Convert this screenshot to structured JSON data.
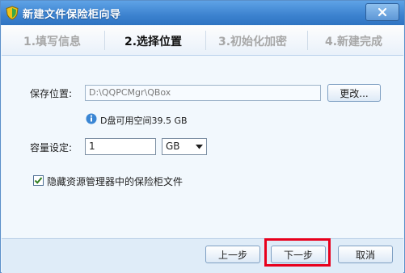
{
  "window": {
    "title": "新建文件保险柜向导",
    "close_icon": "close-icon"
  },
  "steps": [
    {
      "label": "1.填写信息",
      "active": false
    },
    {
      "label": "2.选择位置",
      "active": true
    },
    {
      "label": "3.初始化加密",
      "active": false
    },
    {
      "label": "4.新建完成",
      "active": false
    }
  ],
  "location": {
    "label": "保存位置:",
    "path_value": "D:\\QQPCMgr\\QBox",
    "change_button": "更改..."
  },
  "info": {
    "icon": "info-icon",
    "free_space_text": "D盘可用空间39.5 GB"
  },
  "capacity": {
    "label": "容量设定:",
    "value": "1",
    "unit_selected": "GB"
  },
  "hide_option": {
    "checked": true,
    "label": "隐藏资源管理器中的保险柜文件"
  },
  "footer": {
    "prev_button": "上一步",
    "next_button": "下一步",
    "cancel_button": "取消"
  },
  "colors": {
    "title_bar": "#3c82cf",
    "highlight": "#e8001c",
    "active_step": "#111111",
    "inactive_step": "#a7a7a7"
  }
}
